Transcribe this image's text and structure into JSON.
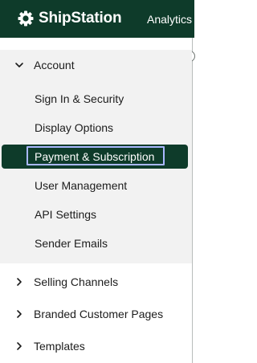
{
  "header": {
    "brand": "ShipStation",
    "brand_icon": "shipstation-gear-logo-icon",
    "nav_link": "Analytics",
    "background_color": "#0e3b2a"
  },
  "sidebar": {
    "collapse_icon": "chevron-left-icon",
    "account": {
      "label": "Account",
      "expanded": true,
      "icon": "chevron-down-icon",
      "items": [
        {
          "label": "Sign In & Security",
          "active": false
        },
        {
          "label": "Display Options",
          "active": false
        },
        {
          "label": "Payment & Subscription",
          "active": true
        },
        {
          "label": "User Management",
          "active": false
        },
        {
          "label": "API Settings",
          "active": false
        },
        {
          "label": "Sender Emails",
          "active": false
        }
      ]
    },
    "sections": [
      {
        "label": "Selling Channels",
        "expanded": false,
        "icon": "chevron-right-icon"
      },
      {
        "label": "Branded Customer Pages",
        "expanded": false,
        "icon": "chevron-right-icon"
      },
      {
        "label": "Templates",
        "expanded": false,
        "icon": "chevron-right-icon"
      }
    ],
    "colors": {
      "active_background": "#0e3b2a",
      "group_background": "#f2f2f2",
      "focus_ring": "#aab8ff"
    }
  }
}
